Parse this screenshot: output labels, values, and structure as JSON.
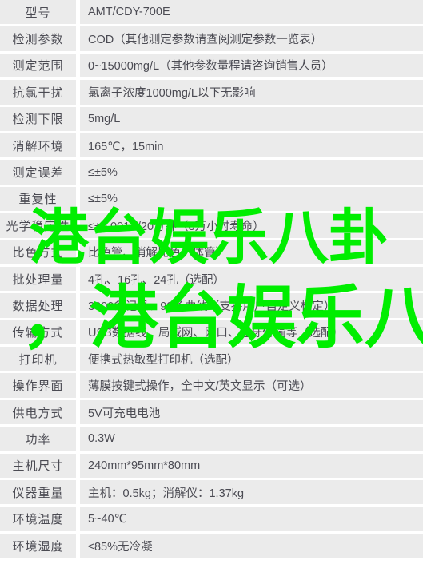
{
  "table": {
    "rows": [
      {
        "label": "型号",
        "value": "AMT/CDY-700E"
      },
      {
        "label": "检测参数",
        "value": "COD（其他测定参数请查阅测定参数一览表）"
      },
      {
        "label": "测定范围",
        "value": "0~15000mg/L（其他参数量程请咨询销售人员）"
      },
      {
        "label": "抗氯干扰",
        "value": "氯离子浓度1000mg/L以下无影响"
      },
      {
        "label": "检测下限",
        "value": "5mg/L"
      },
      {
        "label": "消解环境",
        "value": "165℃，15min"
      },
      {
        "label": "测定误差",
        "value": "≤±5%"
      },
      {
        "label": "重复性",
        "value": "≤±5%"
      },
      {
        "label": "光学稳定性",
        "value": "≤±0.001A/20分钟（8万小时寿命）"
      },
      {
        "label": "比色方式",
        "value": "比色管、消解比色一体管）"
      },
      {
        "label": "批处理量",
        "value": "4孔、16孔、24孔（选配）"
      },
      {
        "label": "数据处理",
        "value": "3000条记录、99条曲线（支持用户自定义标定）"
      },
      {
        "label": "传输方式",
        "value": "USB数据线、局域网、网口、蓝牙传输等（选配）"
      },
      {
        "label": "打印机",
        "value": "便携式热敏型打印机（选配）"
      },
      {
        "label": "操作界面",
        "value": "薄膜按键式操作，全中文/英文显示（可选）"
      },
      {
        "label": "供电方式",
        "value": "5V可充电电池"
      },
      {
        "label": "功率",
        "value": "0.3W"
      },
      {
        "label": "主机尺寸",
        "value": "240mm*95mm*80mm"
      },
      {
        "label": "仪器重量",
        "value": "主机：0.5kg；消解仪：1.37kg"
      },
      {
        "label": "环境温度",
        "value": "5~40℃"
      },
      {
        "label": "环境湿度",
        "value": "≤85%无冷凝"
      }
    ]
  },
  "watermark": {
    "line1": "港台娱乐八卦",
    "line2": "，港台娱乐八卦",
    "color": "#00ee00"
  },
  "colors": {
    "row_background": "#ebebeb",
    "row_separator": "#ffffff",
    "text": "#4b4b53",
    "watermark_green": "#00ee00"
  }
}
